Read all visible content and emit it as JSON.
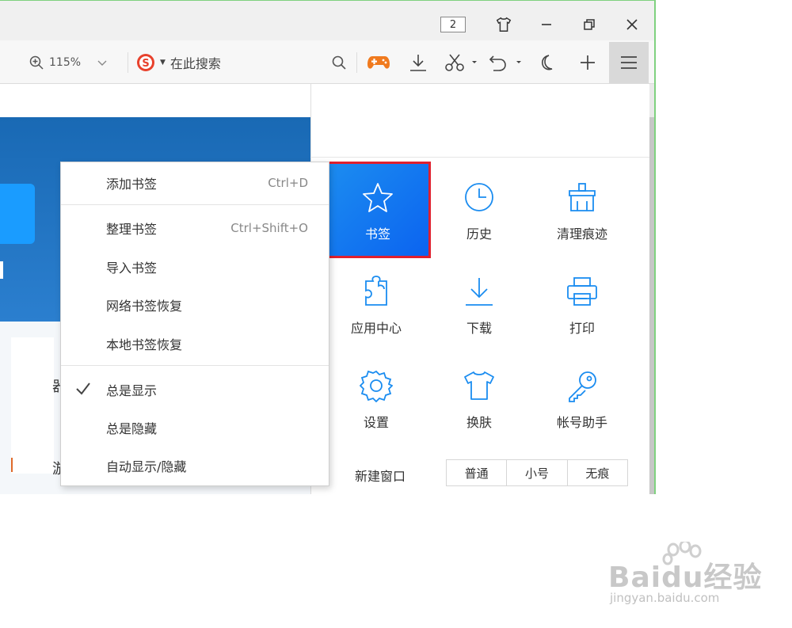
{
  "titlebar": {
    "tab_count": "2"
  },
  "toolbar": {
    "zoom_level": "115%",
    "search_placeholder": "在此搜索"
  },
  "page_fragments": {
    "frag_a": "器",
    "frag_b": "游"
  },
  "bookmark_menu": {
    "items": [
      {
        "label": "添加书签",
        "shortcut": "Ctrl+D"
      },
      {
        "label": "整理书签",
        "shortcut": "Ctrl+Shift+O"
      },
      {
        "label": "导入书签"
      },
      {
        "label": "网络书签恢复"
      },
      {
        "label": "本地书签恢复"
      },
      {
        "label": "总是显示",
        "checked": true
      },
      {
        "label": "总是隐藏"
      },
      {
        "label": "自动显示/隐藏"
      }
    ]
  },
  "panel": {
    "tiles": [
      {
        "label": "书签",
        "icon": "star-icon",
        "selected": true
      },
      {
        "label": "历史",
        "icon": "clock-icon"
      },
      {
        "label": "清理痕迹",
        "icon": "broom-icon"
      },
      {
        "label": "应用中心",
        "icon": "puzzle-icon"
      },
      {
        "label": "下载",
        "icon": "download-icon"
      },
      {
        "label": "打印",
        "icon": "printer-icon"
      },
      {
        "label": "设置",
        "icon": "gear-icon"
      },
      {
        "label": "换肤",
        "icon": "shirt-icon"
      },
      {
        "label": "帐号助手",
        "icon": "key-icon"
      }
    ],
    "new_window": {
      "label": "新建窗口",
      "options": [
        "普通",
        "小号",
        "无痕"
      ]
    }
  },
  "watermark": {
    "logo_text": "Baidu经验",
    "url": "jingyan.baidu.com"
  },
  "colors": {
    "accent_blue": "#1a8cf0",
    "selection_red": "#e0202e",
    "game_orange": "#f07a1e",
    "sogou_red": "#e8412c"
  }
}
